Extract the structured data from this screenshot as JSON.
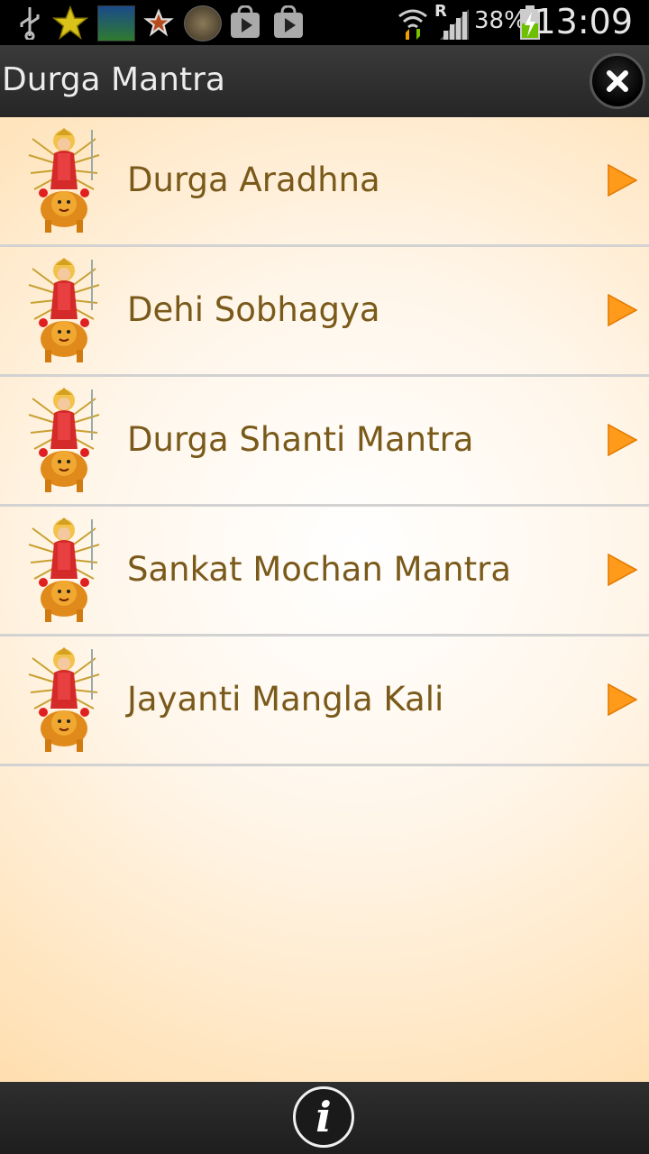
{
  "status_bar": {
    "battery_text": "38%",
    "clock": "13:09",
    "roaming": "R",
    "icons": [
      "usb-icon",
      "star-icon",
      "app-thumbnail-icon",
      "star-outline-icon",
      "app-thumbnail-icon",
      "play-store-icon",
      "play-store-icon",
      "wifi-icon",
      "signal-icon",
      "battery-charging-icon"
    ]
  },
  "titlebar": {
    "title": "Durga Mantra"
  },
  "list": {
    "items": [
      {
        "label": "Durga Aradhna"
      },
      {
        "label": "Dehi Sobhagya"
      },
      {
        "label": "Durga Shanti Mantra"
      },
      {
        "label": "Sankat Mochan Mantra"
      },
      {
        "label": "Jayanti Mangla Kali"
      }
    ]
  },
  "colors": {
    "accent_arrow": "#ff9a1a",
    "label_text": "#7a5a1a",
    "bar_background": "#2a2a2a"
  }
}
